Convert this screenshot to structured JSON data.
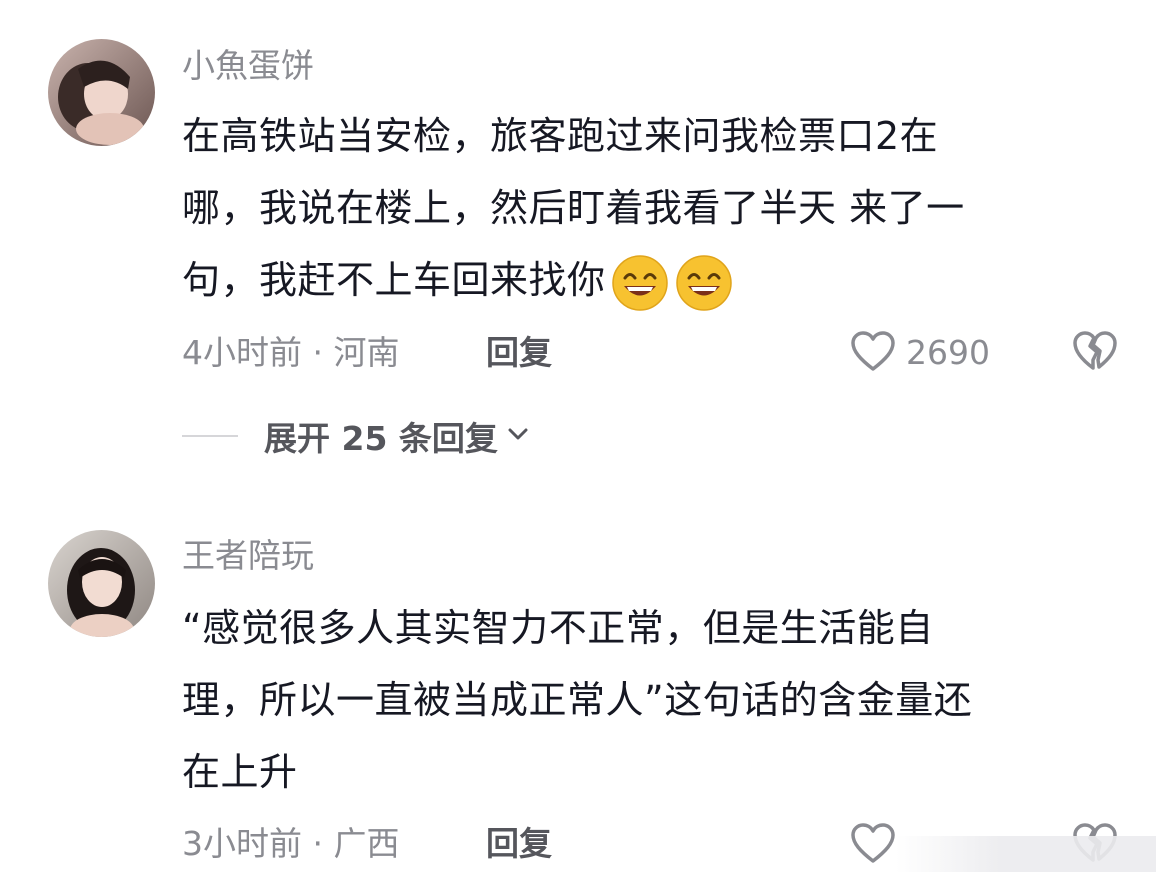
{
  "comments": [
    {
      "username": "小魚蛋饼",
      "text_lines": [
        "在高铁站当安检，旅客跑过来问我检票口2在",
        "哪，我说在楼上，然后盯着我看了半天 来了一",
        "句，我赶不上车回来找你"
      ],
      "emojis": [
        "grin-emoji",
        "grin-emoji"
      ],
      "time_location": "4小时前 · 河南",
      "reply_label": "回复",
      "likes": "2690",
      "expand_label": "展开 25 条回复"
    },
    {
      "username": "王者陪玩",
      "text_lines": [
        "“感觉很多人其实智力不正常，但是生活能自",
        "理，所以一直被当成正常人”这句话的含金量还",
        "在上升"
      ],
      "time_location": "3小时前 · 广西",
      "reply_label": "回复"
    }
  ],
  "colors": {
    "primary_text": "#161823",
    "secondary_text": "#8a8b91",
    "reply_text": "#55565c",
    "emoji_fill": "#f7c230"
  },
  "icons": {
    "like": "heart-outline-icon",
    "dislike": "broken-heart-icon",
    "expand": "chevron-down-icon"
  }
}
